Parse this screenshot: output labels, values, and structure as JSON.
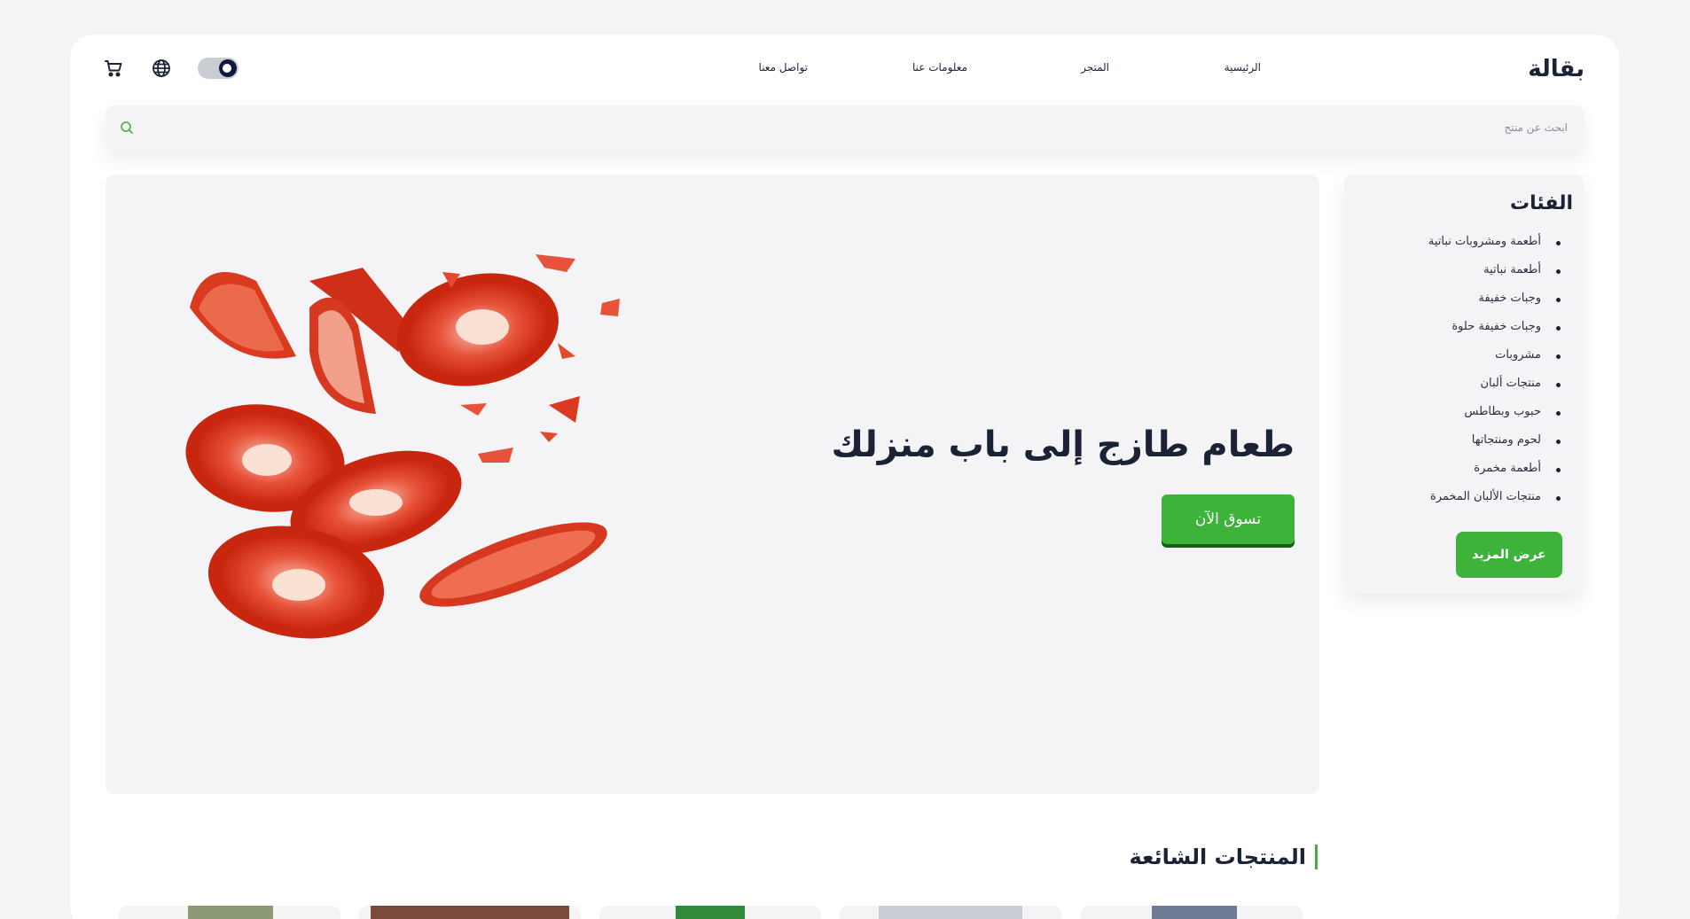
{
  "header": {
    "brand": "بقالة",
    "nav": [
      "الرئيسية",
      "المتجر",
      "معلومات عنا",
      "تواصل معنا"
    ],
    "icons": [
      "cart-icon",
      "globe-icon",
      "theme-toggle"
    ]
  },
  "search": {
    "placeholder": "ابحث عن منتج",
    "icon": "search-icon"
  },
  "hero": {
    "title": "طعام طازج إلى باب منزلك",
    "cta": "تسوق الآن"
  },
  "categories": {
    "title": "الفئات",
    "items": [
      "أطعمة ومشروبات نباتية",
      "أطعمة نباتية",
      "وجبات خفيفة",
      "وجبات خفيفة حلوة",
      "مشروبات",
      "منتجات ألبان",
      "حبوب وبطاطس",
      "لحوم ومنتجاتها",
      "أطعمة مخمرة",
      "منتجات الألبان المخمرة"
    ],
    "more": "عرض المزيد"
  },
  "popular": {
    "title": "المنتجات الشائعة"
  },
  "colors": {
    "accent": "#3db33a",
    "dark": "#1b2236",
    "surface": "#f4f4f6"
  }
}
